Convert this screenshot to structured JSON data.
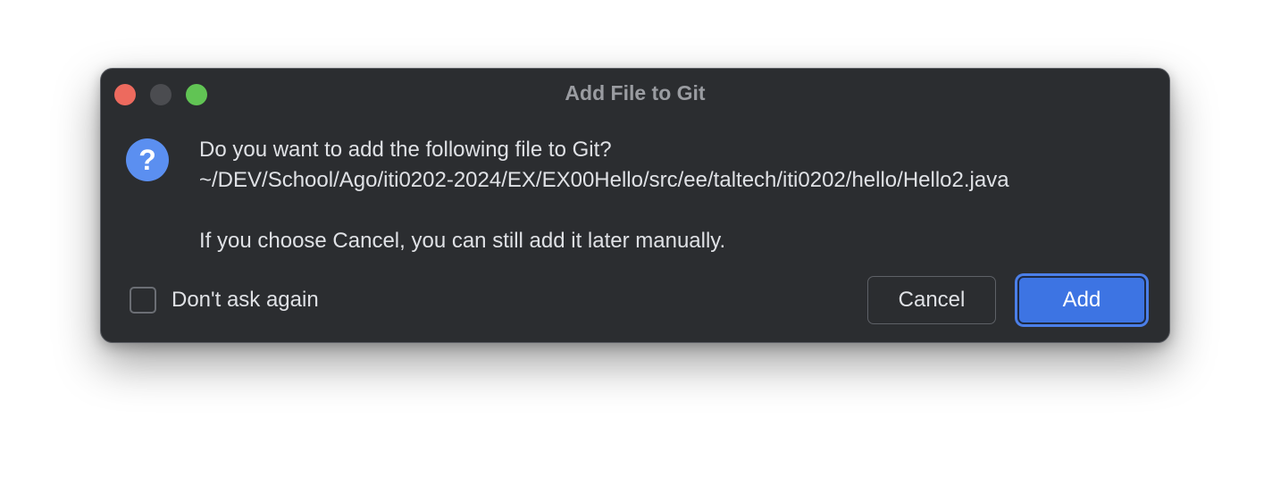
{
  "window": {
    "title": "Add File to Git"
  },
  "icons": {
    "question": "question-icon",
    "question_glyph": "?"
  },
  "message": {
    "question": "Do you want to add the following file to Git?",
    "path": "~/DEV/School/Ago/iti0202-2024/EX/EX00Hello/src/ee/taltech/iti0202/hello/Hello2.java",
    "note": "If you choose Cancel, you can still add it later manually."
  },
  "options": {
    "dont_ask_label": "Don't ask again",
    "dont_ask_checked": false
  },
  "buttons": {
    "cancel_label": "Cancel",
    "add_label": "Add"
  },
  "colors": {
    "dialog_bg": "#2b2d30",
    "accent": "#3d74e3",
    "question_icon": "#5b8ff0",
    "close": "#ed6a5e",
    "zoom": "#61c454"
  }
}
